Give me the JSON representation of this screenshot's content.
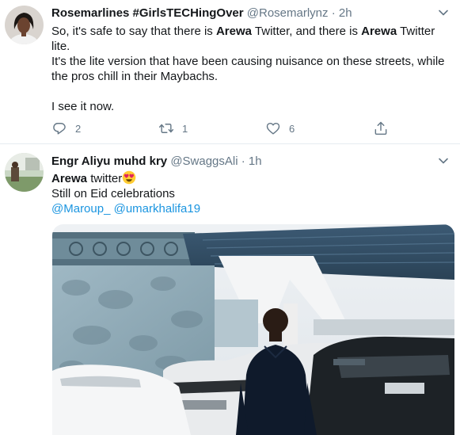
{
  "tweets": [
    {
      "display_name": "Rosemarlines #GirlsTECHingOver",
      "handle": "@Rosemarlynz",
      "separator": "·",
      "time": "2h",
      "body": {
        "l1_pre": "So, it's safe to say that there is ",
        "l1_bold1": "Arewa",
        "l1_mid": " Twitter, and there is ",
        "l1_bold2": "Arewa",
        "l1_post": " Twitter",
        "l2": "lite.",
        "l3": "It's the lite version that have been causing nuisance on these streets, while",
        "l4": "the pros chill in their Maybachs.",
        "l5": "I see it now."
      },
      "actions": {
        "reply_count": "2",
        "retweet_count": "1",
        "like_count": "6"
      },
      "icons": {
        "reply": "reply-icon",
        "retweet": "retweet-icon",
        "like": "heart-icon",
        "share": "share-icon",
        "menu": "chevron-down-icon"
      }
    },
    {
      "display_name": "Engr Aliyu muhd kry",
      "handle": "@SwaggsAli",
      "separator": "·",
      "time": "1h",
      "body": {
        "l1_bold": "Arewa",
        "l1_post": " twitter",
        "emoji": "heart-eyes-emoji",
        "l2": "Still on Eid celebrations",
        "mention1": "@Maroup_",
        "mention2": "@umarkhalifa19"
      },
      "icons": {
        "menu": "chevron-down-icon"
      }
    }
  ],
  "colors": {
    "text": "#14171a",
    "muted": "#657786",
    "link": "#1b95e0",
    "divider": "#e6ecf0"
  }
}
